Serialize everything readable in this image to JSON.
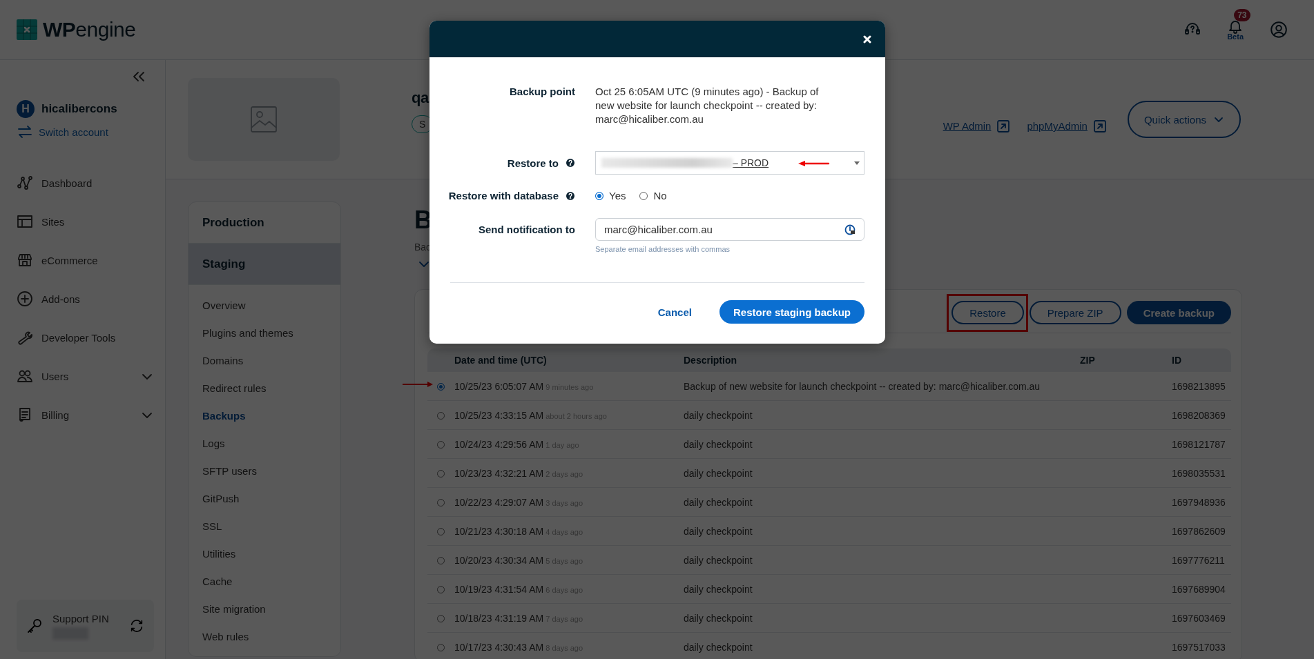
{
  "header": {
    "logo": {
      "mark": "WP",
      "word": "engine"
    },
    "notifications": {
      "count": "73",
      "label": "Beta"
    }
  },
  "sidebar": {
    "account": {
      "initial": "H",
      "name": "hicalibercons",
      "switch_label": "Switch account"
    },
    "items": [
      {
        "label": "Dashboard",
        "expandable": false
      },
      {
        "label": "Sites",
        "expandable": false
      },
      {
        "label": "eCommerce",
        "expandable": false
      },
      {
        "label": "Add-ons",
        "expandable": false
      },
      {
        "label": "Developer Tools",
        "expandable": false
      },
      {
        "label": "Users",
        "expandable": true
      },
      {
        "label": "Billing",
        "expandable": true
      }
    ],
    "support_pin": {
      "label": "Support PIN"
    }
  },
  "site": {
    "name": "qa",
    "tag": "S",
    "links": [
      {
        "label": "WP Admin"
      },
      {
        "label": "phpMyAdmin"
      }
    ],
    "quick_actions": "Quick actions"
  },
  "environments": [
    {
      "label": "Production",
      "selected": false
    },
    {
      "label": "Staging",
      "selected": true
    }
  ],
  "subnav": [
    {
      "label": "Overview",
      "selected": false
    },
    {
      "label": "Plugins and themes",
      "selected": false
    },
    {
      "label": "Domains",
      "selected": false
    },
    {
      "label": "Redirect rules",
      "selected": false
    },
    {
      "label": "Backups",
      "selected": true
    },
    {
      "label": "Logs",
      "selected": false
    },
    {
      "label": "SFTP users",
      "selected": false
    },
    {
      "label": "GitPush",
      "selected": false
    },
    {
      "label": "SSL",
      "selected": false
    },
    {
      "label": "Utilities",
      "selected": false
    },
    {
      "label": "Cache",
      "selected": false
    },
    {
      "label": "Site migration",
      "selected": false
    },
    {
      "label": "Web rules",
      "selected": false
    }
  ],
  "page": {
    "heading": "B",
    "description": "Bac"
  },
  "backups": {
    "buttons": [
      {
        "label": "Restore",
        "kind": "outline",
        "highlighted": true
      },
      {
        "label": "Prepare ZIP",
        "kind": "outline",
        "highlighted": false
      },
      {
        "label": "Create backup",
        "kind": "primary",
        "highlighted": false
      }
    ],
    "columns": [
      "Date and time (UTC)",
      "Description",
      "ZIP",
      "ID"
    ],
    "rows": [
      {
        "selected": true,
        "pointer_arrow": true,
        "date": "10/25/23 6:05:07 AM",
        "ago": "9 minutes ago",
        "description": "Backup of new website for launch checkpoint -- created by: marc@hicaliber.com.au",
        "id": "1698213895"
      },
      {
        "selected": false,
        "pointer_arrow": false,
        "date": "10/25/23 4:33:15 AM",
        "ago": "about 2 hours ago",
        "description": "daily checkpoint",
        "id": "1698208369"
      },
      {
        "selected": false,
        "pointer_arrow": false,
        "date": "10/24/23 4:29:56 AM",
        "ago": "1 day ago",
        "description": "daily checkpoint",
        "id": "1698121787"
      },
      {
        "selected": false,
        "pointer_arrow": false,
        "date": "10/23/23 4:32:21 AM",
        "ago": "2 days ago",
        "description": "daily checkpoint",
        "id": "1698035531"
      },
      {
        "selected": false,
        "pointer_arrow": false,
        "date": "10/22/23 4:29:07 AM",
        "ago": "3 days ago",
        "description": "daily checkpoint",
        "id": "1697948936"
      },
      {
        "selected": false,
        "pointer_arrow": false,
        "date": "10/21/23 4:30:18 AM",
        "ago": "4 days ago",
        "description": "daily checkpoint",
        "id": "1697862609"
      },
      {
        "selected": false,
        "pointer_arrow": false,
        "date": "10/20/23 4:30:34 AM",
        "ago": "5 days ago",
        "description": "daily checkpoint",
        "id": "1697776211"
      },
      {
        "selected": false,
        "pointer_arrow": false,
        "date": "10/19/23 4:31:54 AM",
        "ago": "6 days ago",
        "description": "daily checkpoint",
        "id": "1697689904"
      },
      {
        "selected": false,
        "pointer_arrow": false,
        "date": "10/18/23 4:31:19 AM",
        "ago": "7 days ago",
        "description": "daily checkpoint",
        "id": "1697603469"
      },
      {
        "selected": false,
        "pointer_arrow": false,
        "date": "10/17/23 4:30:43 AM",
        "ago": "8 days ago",
        "description": "daily checkpoint",
        "id": "1697517033"
      }
    ]
  },
  "modal": {
    "backup_point": {
      "label": "Backup point",
      "value": "Oct 25 6:05AM UTC (9 minutes ago) - Backup of new website for launch checkpoint -- created by: marc@hicaliber.com.au"
    },
    "restore_to": {
      "label": "Restore to",
      "value_suffix": "– PROD",
      "pointer_arrow": true
    },
    "restore_database": {
      "label": "Restore with database",
      "options": [
        {
          "label": "Yes",
          "selected": true
        },
        {
          "label": "No",
          "selected": false
        }
      ]
    },
    "notify": {
      "label": "Send notification to",
      "value": "marc@hicaliber.com.au",
      "hint": "Separate email addresses with commas"
    },
    "cancel": "Cancel",
    "submit": "Restore staging backup"
  }
}
